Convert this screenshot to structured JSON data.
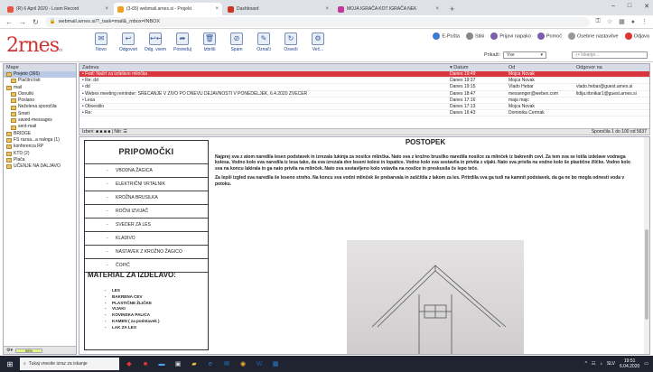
{
  "browser": {
    "tabs": [
      {
        "title": "(R) 6 April 2020 - Loom Record",
        "color": "#e7543f",
        "active": false
      },
      {
        "title": "(3-65) webmail.arnes.si - Projekt",
        "color": "#f0a020",
        "active": true
      },
      {
        "title": "Dashboard",
        "color": "#cc3322",
        "active": false
      },
      {
        "title": "MOJA IGRAČA KOT IGRAČA NEK",
        "color": "#c03a9b",
        "active": false
      }
    ],
    "new_tab": "+",
    "url": "webmail.arnes.si/?_task=mail&_mbox=INBOX",
    "window_controls": [
      "–",
      "□",
      "✕"
    ]
  },
  "app": {
    "logo": "2rnes",
    "logo_sub": "m",
    "toolbar": [
      "Novo",
      "Odgovori",
      "Odg. vsem",
      "Posreduj",
      "Izbriši",
      "Spam",
      "Označi",
      "Osveži",
      "Več..."
    ],
    "top_links": [
      "E-Pošta",
      "Stiki",
      "Prijavi napako",
      "Pomoč",
      "Osebne nastavitve",
      "Odjava"
    ],
    "view_label": "Prikaži:",
    "view_value": "Vse",
    "search_placeholder": "Iskanje..."
  },
  "sidebar": {
    "header": "Mape",
    "items": [
      {
        "label": "Prejeto (365)",
        "selected": true,
        "sub": false
      },
      {
        "label": "Plačilni listi",
        "selected": false,
        "sub": true
      },
      {
        "label": "mail",
        "selected": false,
        "sub": false
      },
      {
        "label": "Osnutki",
        "selected": false,
        "sub": true
      },
      {
        "label": "Poslano",
        "selected": false,
        "sub": true
      },
      {
        "label": "Neželena sporočila",
        "selected": false,
        "sub": true
      },
      {
        "label": "Smeti",
        "selected": false,
        "sub": true
      },
      {
        "label": "saved-messages",
        "selected": false,
        "sub": true
      },
      {
        "label": "sent-mail",
        "selected": false,
        "sub": true
      },
      {
        "label": "BRIDGE",
        "selected": false,
        "sub": false
      },
      {
        "label": "FS razsa...a naloga (1)",
        "selected": false,
        "sub": false
      },
      {
        "label": "konferenca RP",
        "selected": false,
        "sub": false
      },
      {
        "label": "KTD (2)",
        "selected": false,
        "sub": false
      },
      {
        "label": "Plača",
        "selected": false,
        "sub": false
      },
      {
        "label": "UČENJE NA DALJAVO",
        "selected": false,
        "sub": false
      }
    ],
    "quota": "96%"
  },
  "maillist": {
    "headers": [
      "Zadeva",
      "Datum",
      "Od",
      "Odgovor na"
    ],
    "rows": [
      {
        "subject": "Fwd: Načrt za izdelavo mlinčka",
        "date": "Danes 19:49",
        "from": "Mojca Novak",
        "reply": "",
        "selected": true
      },
      {
        "subject": "Re: dd",
        "date": "Danes 19:37",
        "from": "Mojca Novak",
        "reply": "",
        "selected": false
      },
      {
        "subject": "dd",
        "date": "Danes 19:15",
        "from": "Vlado Hebar",
        "reply": "vlado.hebar@guest.arnes.si",
        "selected": false
      },
      {
        "subject": "Webex meeting reminder: SREČANJE V ŽIVO PO DNEVU DEJAVNOSTI V PONEDELJEK, 6.4.2020 ZVEČER",
        "date": "Danes 18:47",
        "from": "messenger@webex.com",
        "reply": "lidija.ribnikar1@guest.arnes.si",
        "selected": false
      },
      {
        "subject": "Lesa",
        "date": "Danes 17:16",
        "from": "maja majc",
        "reply": "",
        "selected": false
      },
      {
        "subject": "Obvestilo",
        "date": "Danes 17:13",
        "from": "Mojca Novak",
        "reply": "",
        "selected": false
      },
      {
        "subject": "Re:",
        "date": "Danes 16:43",
        "from": "Dominika Čermak",
        "reply": "",
        "selected": false
      }
    ],
    "footer_left": "Izberi: ■ ■ ■ ■ | Niti: ☰",
    "footer_right": "Sporočila 1 do 100 od 5637"
  },
  "document": {
    "left_title": "PRIPOMOČKI",
    "tools": [
      "VBODNA ŽAGICA",
      "ELEKTRIČNI VRTALNIK",
      "KROŽNA BRUSILKA",
      "ROČNI IZVIJAČ",
      "SVEDER ZA LES",
      "KLADIVO",
      "NASTAVEK Z KROŽNO ŽAGICO",
      "ČOPIČ"
    ],
    "materials_title": "MATERIAL ZA IZDELAVO:",
    "materials": [
      "LES",
      "BAKRENA CEV",
      "PLASTIČNE ŽLIČKE",
      "VIJAKI",
      "KOVINSKA PALICA",
      "KAMEN ( za podstavek )",
      "LAK ZA LES"
    ],
    "right_title": "POSTOPEK",
    "para1": "Najprej sva z atom naredila lesen podstavek in izrezala lukinja za nosilce mlinčka. Nato sva z krožno brusilko naredila nosilce za mlinček iz bakrenih cevi. Za tem sva se lotila izdelave vodnega kolesa. Vodno kolo sva naredila iz lesa tako, da sva izrezala dve leseni kolesi in lopatice. Vodno kolo sva sestavila in privila z vijaki. Nato sva privila na vodno kolo še plastične žličke. Vodno kolo sva na koncu lakirala in ga nato privila na mlinček. Nato sva sestavljeno kolo vstavila na nosilce in preskusila če lepo teče.",
    "para2": "Za lepši izgled sva naredila še leseno streho. Na koncu sva vodni mlinček še prebarvala in zaščitila z lakom za les. Pritrdila sva ga tudi na kamnit podstavek, da ga ne bo mogla odnesti voda v potoku."
  },
  "taskbar": {
    "search_placeholder": "Tukaj vnesite izraz za iskanje",
    "time": "19:51",
    "date": "6.04.2020",
    "lang": "SLV"
  },
  "colors": {
    "accent_red": "#d9363e",
    "logo": "#cc3333",
    "taskbar": "#1f2430"
  }
}
